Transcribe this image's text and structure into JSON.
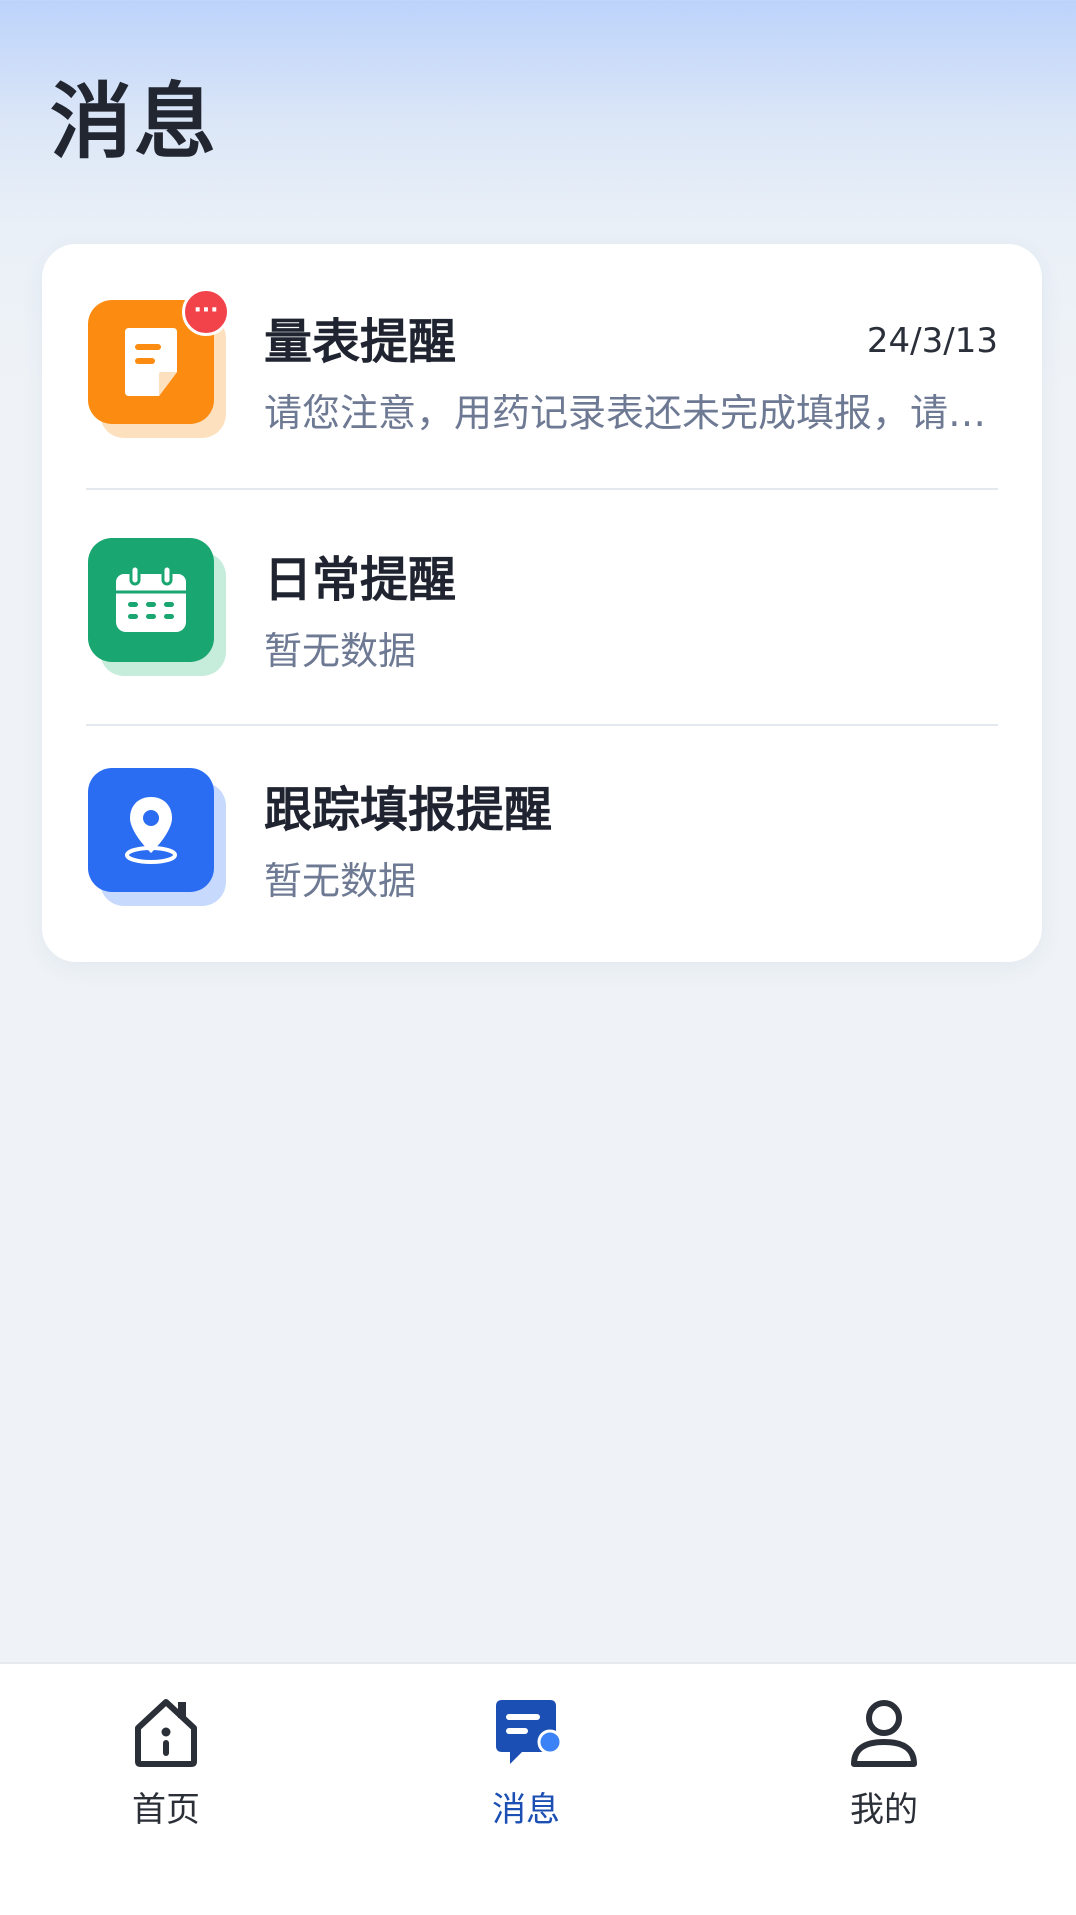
{
  "header": {
    "title": "消息"
  },
  "messages": [
    {
      "title": "量表提醒",
      "subtitle": "请您注意，用药记录表还未完成填报，请及时填报",
      "time": "24/3/13",
      "badge": "···",
      "icon": "note-icon",
      "color": "#fb8c11"
    },
    {
      "title": "日常提醒",
      "subtitle": "暂无数据",
      "icon": "calendar-icon",
      "color": "#1aa670"
    },
    {
      "title": "跟踪填报提醒",
      "subtitle": "暂无数据",
      "icon": "location-pin-icon",
      "color": "#2b6df2"
    }
  ],
  "tabbar": {
    "items": [
      {
        "label": "首页",
        "icon": "home-icon",
        "active": false
      },
      {
        "label": "消息",
        "icon": "message-icon",
        "active": true
      },
      {
        "label": "我的",
        "icon": "user-icon",
        "active": false
      }
    ],
    "active_color": "#1c4fb3"
  }
}
